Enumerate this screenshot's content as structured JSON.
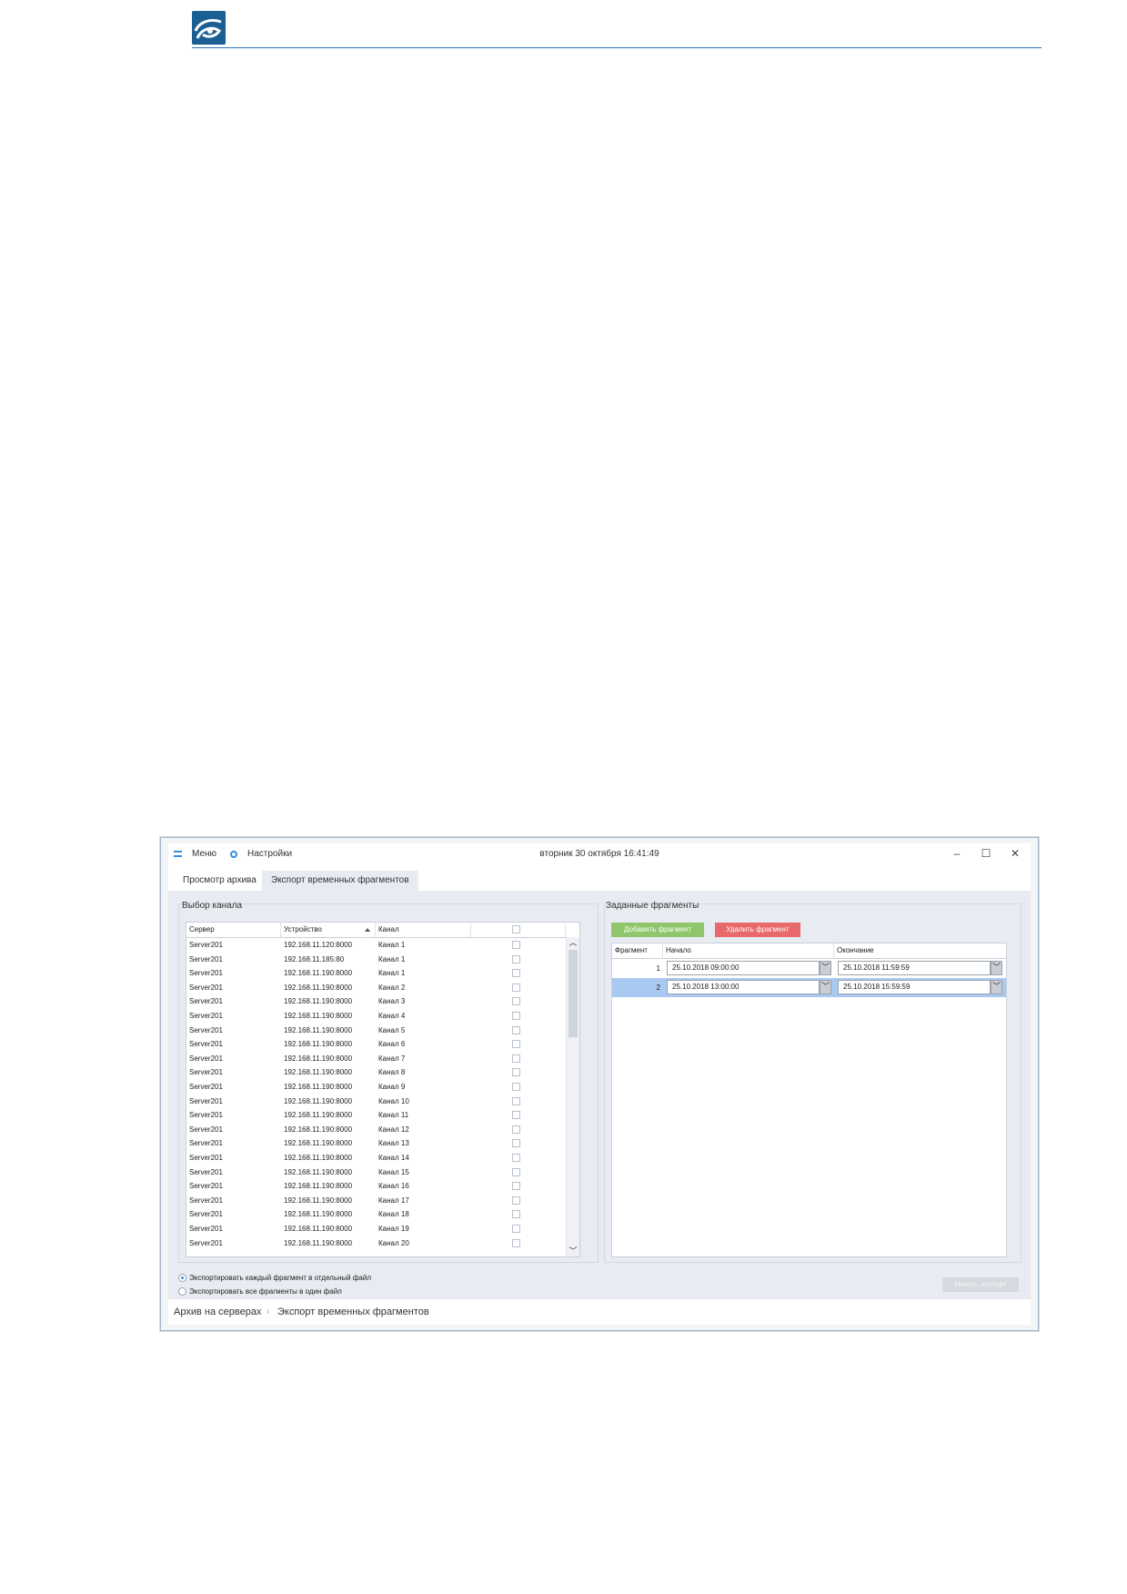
{
  "window": {
    "menu_label": "Меню",
    "settings_label": "Настройки",
    "datetime": "вторник 30 октября 16:41:49",
    "minimize_glyph": "–",
    "maximize_glyph": "☐",
    "close_glyph": "✕"
  },
  "tabs": [
    {
      "label": "Просмотр архива"
    },
    {
      "label": "Экспорт временных фрагментов"
    }
  ],
  "channel_panel": {
    "title": "Выбор канала",
    "columns": [
      "Сервер",
      "Устройство",
      "Канал"
    ],
    "rows": [
      {
        "server": "Server201",
        "device": "192.168.11.120:8000",
        "channel": "Канал 1"
      },
      {
        "server": "Server201",
        "device": "192.168.11.185:80",
        "channel": "Канал 1"
      },
      {
        "server": "Server201",
        "device": "192.168.11.190:8000",
        "channel": "Канал 1"
      },
      {
        "server": "Server201",
        "device": "192.168.11.190:8000",
        "channel": "Канал 2"
      },
      {
        "server": "Server201",
        "device": "192.168.11.190:8000",
        "channel": "Канал 3"
      },
      {
        "server": "Server201",
        "device": "192.168.11.190:8000",
        "channel": "Канал 4"
      },
      {
        "server": "Server201",
        "device": "192.168.11.190:8000",
        "channel": "Канал 5"
      },
      {
        "server": "Server201",
        "device": "192.168.11.190:8000",
        "channel": "Канал 6"
      },
      {
        "server": "Server201",
        "device": "192.168.11.190:8000",
        "channel": "Канал 7"
      },
      {
        "server": "Server201",
        "device": "192.168.11.190:8000",
        "channel": "Канал 8"
      },
      {
        "server": "Server201",
        "device": "192.168.11.190:8000",
        "channel": "Канал 9"
      },
      {
        "server": "Server201",
        "device": "192.168.11.190:8000",
        "channel": "Канал 10"
      },
      {
        "server": "Server201",
        "device": "192.168.11.190:8000",
        "channel": "Канал 11"
      },
      {
        "server": "Server201",
        "device": "192.168.11.190:8000",
        "channel": "Канал 12"
      },
      {
        "server": "Server201",
        "device": "192.168.11.190:8000",
        "channel": "Канал 13"
      },
      {
        "server": "Server201",
        "device": "192.168.11.190:8000",
        "channel": "Канал 14"
      },
      {
        "server": "Server201",
        "device": "192.168.11.190:8000",
        "channel": "Канал 15"
      },
      {
        "server": "Server201",
        "device": "192.168.11.190:8000",
        "channel": "Канал 16"
      },
      {
        "server": "Server201",
        "device": "192.168.11.190:8000",
        "channel": "Канал 17"
      },
      {
        "server": "Server201",
        "device": "192.168.11.190:8000",
        "channel": "Канал 18"
      },
      {
        "server": "Server201",
        "device": "192.168.11.190:8000",
        "channel": "Канал 19"
      },
      {
        "server": "Server201",
        "device": "192.168.11.190:8000",
        "channel": "Канал 20"
      }
    ]
  },
  "fragments_panel": {
    "title": "Заданные фрагменты",
    "add_button": "Добавить фрагмент",
    "delete_button": "Удалить фрагмент",
    "columns": [
      "Фрагмент",
      "Начало",
      "Окончание"
    ],
    "rows": [
      {
        "num": "1",
        "start": "25.10.2018  09:00:00",
        "end": "25.10.2018  11:59:59"
      },
      {
        "num": "2",
        "start": "25.10.2018  13:00:00",
        "end": "25.10.2018  15:59:59"
      }
    ]
  },
  "export_options": [
    {
      "label": "Экспортировать каждый фрагмент в отдельный файл",
      "selected": true
    },
    {
      "label": "Экспортировать все фрагменты в один файл",
      "selected": false
    }
  ],
  "start_export_button": "Начать экспорт",
  "breadcrumb": {
    "root": "Архив на серверах",
    "separator": "›",
    "current": "Экспорт временных фрагментов"
  },
  "colors": {
    "accent": "#2f8ddf",
    "add": "#8fc66b",
    "delete": "#e8696c",
    "selection": "#a9c9f2"
  }
}
